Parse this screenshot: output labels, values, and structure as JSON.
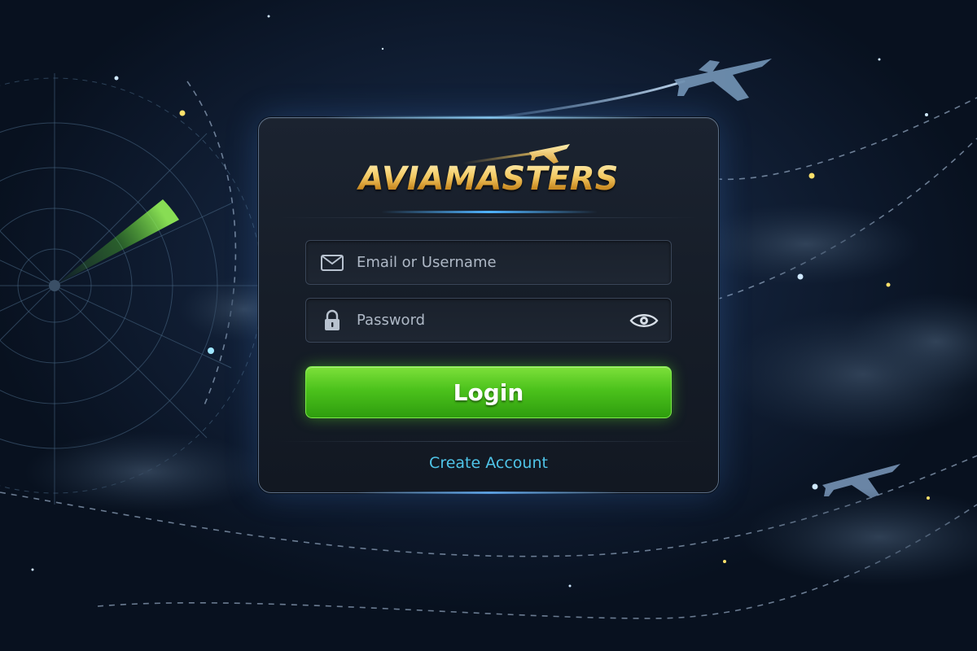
{
  "app": {
    "brand_name": "AVIAMASTERS"
  },
  "login_form": {
    "email_placeholder": "Email or Username",
    "password_placeholder": "Password",
    "login_label": "Login",
    "create_account_label": "Create Account"
  },
  "icons": {
    "email": "envelope-icon",
    "password": "padlock-icon",
    "show_password": "eye-icon",
    "logo_plane": "airplane-icon"
  },
  "colors": {
    "background": "#13223a",
    "panel": "#161d28",
    "brand_gold": "#f2c760",
    "accent_blue": "#4fb3ff",
    "login_green": "#4cc21c",
    "link_cyan": "#4fc4e8",
    "radar_green": "#7cff3a"
  }
}
